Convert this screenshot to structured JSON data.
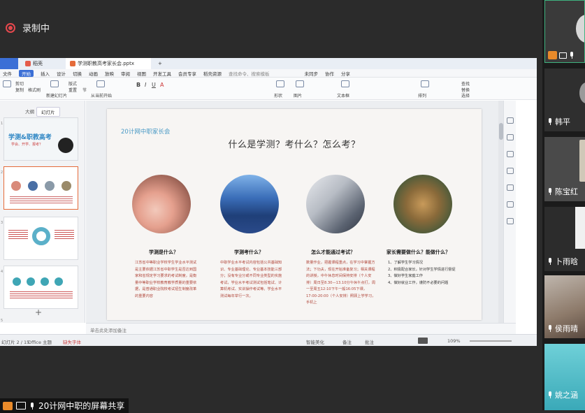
{
  "recording": {
    "label": "录制中"
  },
  "tabs": [
    {
      "label": ""
    },
    {
      "label": "稻壳"
    },
    {
      "label": "学测职教高考家长会.pptx"
    }
  ],
  "menu": [
    "文件",
    "开始",
    "插入",
    "设计",
    "切换",
    "动画",
    "放映",
    "审阅",
    "视图",
    "开发工具",
    "会员专享",
    "稻壳资源",
    "查找命令、搜索模板",
    "未同步",
    "协作",
    "分享"
  ],
  "menu_active_index": 1,
  "ribbon": {
    "cut": "剪切",
    "copy": "复制",
    "format_painter": "格式刷",
    "new_slide": "新建幻灯片",
    "layout": "版式",
    "reset": "重置",
    "section": "节",
    "from_start": "从当前开始",
    "shape": "形状",
    "image": "图片",
    "textbox": "文本框",
    "arrange": "排列",
    "find": "查找",
    "select": "选择",
    "replace": "替换"
  },
  "panel_tabs": {
    "outline": "大纲",
    "slides": "幻灯片"
  },
  "thumbnails": [
    {
      "num": "1",
      "title": "学测&职教高考",
      "subtitle": "学会、开学、报考？"
    },
    {
      "num": "2"
    },
    {
      "num": "3"
    },
    {
      "num": "4"
    },
    {
      "num": "5"
    }
  ],
  "slide": {
    "logo": "20计网中职家长会",
    "title": "什么是学测？考什么？怎么考？",
    "columns": [
      {
        "heading": "学测是什么？",
        "text": "江苏省中等职业学校学生学业水平测试是主要依据江苏省中职学生是否达到国家和省规定学习要求的考试制度，是衡量中等职业学校教育教学质量的重要依据，是普通职业院校考试招生制度改革的重要内容"
      },
      {
        "heading": "学测考什么？",
        "text": "中职学业水平考试内容包括公共基础知识、专业基础理论、专业基本技能三部分；没有专业分或不同专业类型的实施考试，学业水平考试测试包括笔试、计算机考试、实训操作考试等。学业水平测试每年举行一次。"
      },
      {
        "heading": "怎么才能通过考试？",
        "text": "数量作业，把握课程重点，在学习中掌握方法；下功夫，现在开始准备复习；相关课程的讲授，中午休息时间保持安排（个人安排）周日至8.30—13.10分午休午点打，周一至周五12:10下午一般16:05下课，17:00-20:00（个人安排）照顾上学学习，手机上"
      },
      {
        "heading": "家长需要做什么？能做什么？",
        "items": [
          "1、了解学生学习情况",
          "2、积极配合家长，针对学生学情进行督促",
          "3、做好学生家庭工作",
          "4、做好就业工作，谨防不必要的问题"
        ]
      }
    ]
  },
  "notes_placeholder": "单击此处添加备注",
  "status": {
    "slide": "幻灯片 2 / 15",
    "theme": "Office 主题",
    "font_missing": "缺失字体",
    "beautify": "智能美化",
    "notes": "备注",
    "comments": "批注",
    "zoom": "109%"
  },
  "participants": [
    {
      "name": ""
    },
    {
      "name": "韩平"
    },
    {
      "name": "陈宝红"
    },
    {
      "name": "卜雨晗"
    },
    {
      "name": "侯雨晴"
    },
    {
      "name": "姚之涵"
    }
  ],
  "share_label": "20计网中职的屏幕共享",
  "colors": {
    "accent": "#3b6fd6",
    "record": "#e5484d",
    "slide_red_text": "#b0463a",
    "logo_blue": "#4a9ac5"
  }
}
